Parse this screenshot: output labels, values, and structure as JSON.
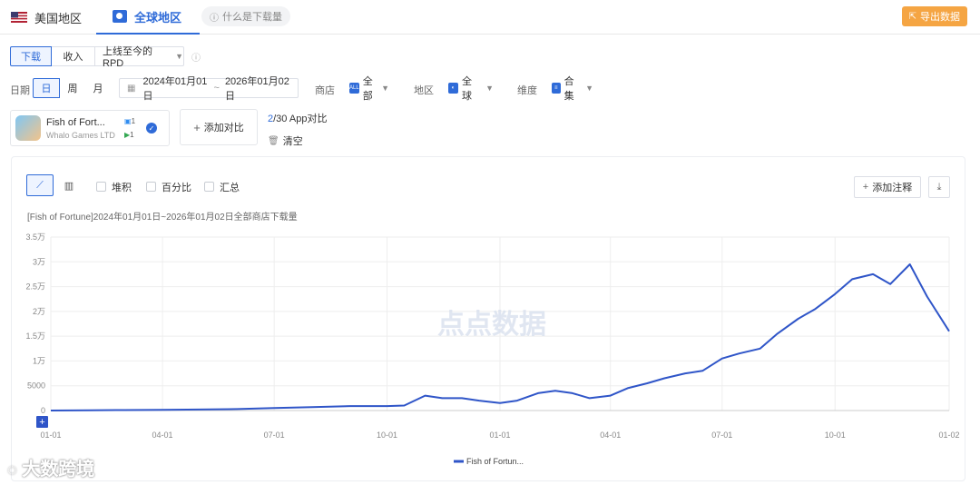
{
  "header": {
    "tab_us": "美国地区",
    "tab_global": "全球地区",
    "what_is_download": "什么是下载量",
    "export": "导出数据"
  },
  "metric_tabs": [
    "下载",
    "收入",
    "上线至今的RPD"
  ],
  "filters": {
    "date_label": "日期",
    "granularity": [
      "日",
      "周",
      "月"
    ],
    "date_start": "2024年01月01日",
    "date_sep": "~",
    "date_end": "2026年01月02日",
    "store_label": "商店",
    "store_value": "全部",
    "region_label": "地区",
    "region_value": "全球",
    "dimension_label": "维度",
    "dimension_value": "合集"
  },
  "app": {
    "name": "Fish of Fort...",
    "developer": "Whalo Games LTD",
    "ios_count": "1",
    "android_count": "1"
  },
  "compare": {
    "add_label": "添加对比",
    "count": "2",
    "count_suffix": "/30 App对比",
    "clear_label": "清空"
  },
  "chart_toolbar": {
    "stack": "堆积",
    "percent": "百分比",
    "summary": "汇总",
    "add_note": "添加注释"
  },
  "watermark": "点点数据",
  "corner_watermark": "大数跨境",
  "colors": {
    "accent": "#2f6bd8",
    "line": "#2f55c8",
    "export": "#f5a543"
  },
  "chart_data": {
    "type": "line",
    "title": "[Fish of Fortune]2024年01月01日~2026年01月02日全部商店下载量",
    "y_tick_labels": [
      "0",
      "5000",
      "1万",
      "1.5万",
      "2万",
      "2.5万",
      "3万",
      "3.5万"
    ],
    "ylim": [
      0,
      35000
    ],
    "x_tick_labels": [
      "01-01",
      "04-01",
      "07-01",
      "10-01",
      "01-01",
      "04-01",
      "07-01",
      "10-01",
      "01-02"
    ],
    "x_tick_dates": [
      "2024-01-01",
      "2024-04-01",
      "2024-07-01",
      "2024-10-01",
      "2025-01-01",
      "2025-04-01",
      "2025-07-01",
      "2025-10-01",
      "2026-01-02"
    ],
    "grid": true,
    "series": [
      {
        "name": "Fish of Fortun...",
        "x": [
          "2024-01-01",
          "2024-02-01",
          "2024-03-01",
          "2024-04-01",
          "2024-05-01",
          "2024-06-01",
          "2024-07-01",
          "2024-08-01",
          "2024-09-01",
          "2024-10-01",
          "2024-10-15",
          "2024-11-01",
          "2024-11-15",
          "2024-12-01",
          "2024-12-15",
          "2025-01-01",
          "2025-01-15",
          "2025-02-01",
          "2025-02-15",
          "2025-03-01",
          "2025-03-15",
          "2025-04-01",
          "2025-04-15",
          "2025-05-01",
          "2025-05-15",
          "2025-06-01",
          "2025-06-15",
          "2025-07-01",
          "2025-07-15",
          "2025-08-01",
          "2025-08-15",
          "2025-09-01",
          "2025-09-15",
          "2025-10-01",
          "2025-10-15",
          "2025-11-01",
          "2025-11-15",
          "2025-12-01",
          "2025-12-15",
          "2026-01-02"
        ],
        "values": [
          0,
          50,
          100,
          150,
          200,
          300,
          500,
          700,
          900,
          900,
          1000,
          3000,
          2500,
          2500,
          2000,
          1500,
          2000,
          3500,
          4000,
          3500,
          2500,
          3000,
          4500,
          5500,
          6500,
          7500,
          8000,
          10500,
          11500,
          12500,
          15500,
          18500,
          20500,
          23500,
          26500,
          27500,
          25500,
          29500,
          23000,
          16000
        ]
      }
    ]
  }
}
